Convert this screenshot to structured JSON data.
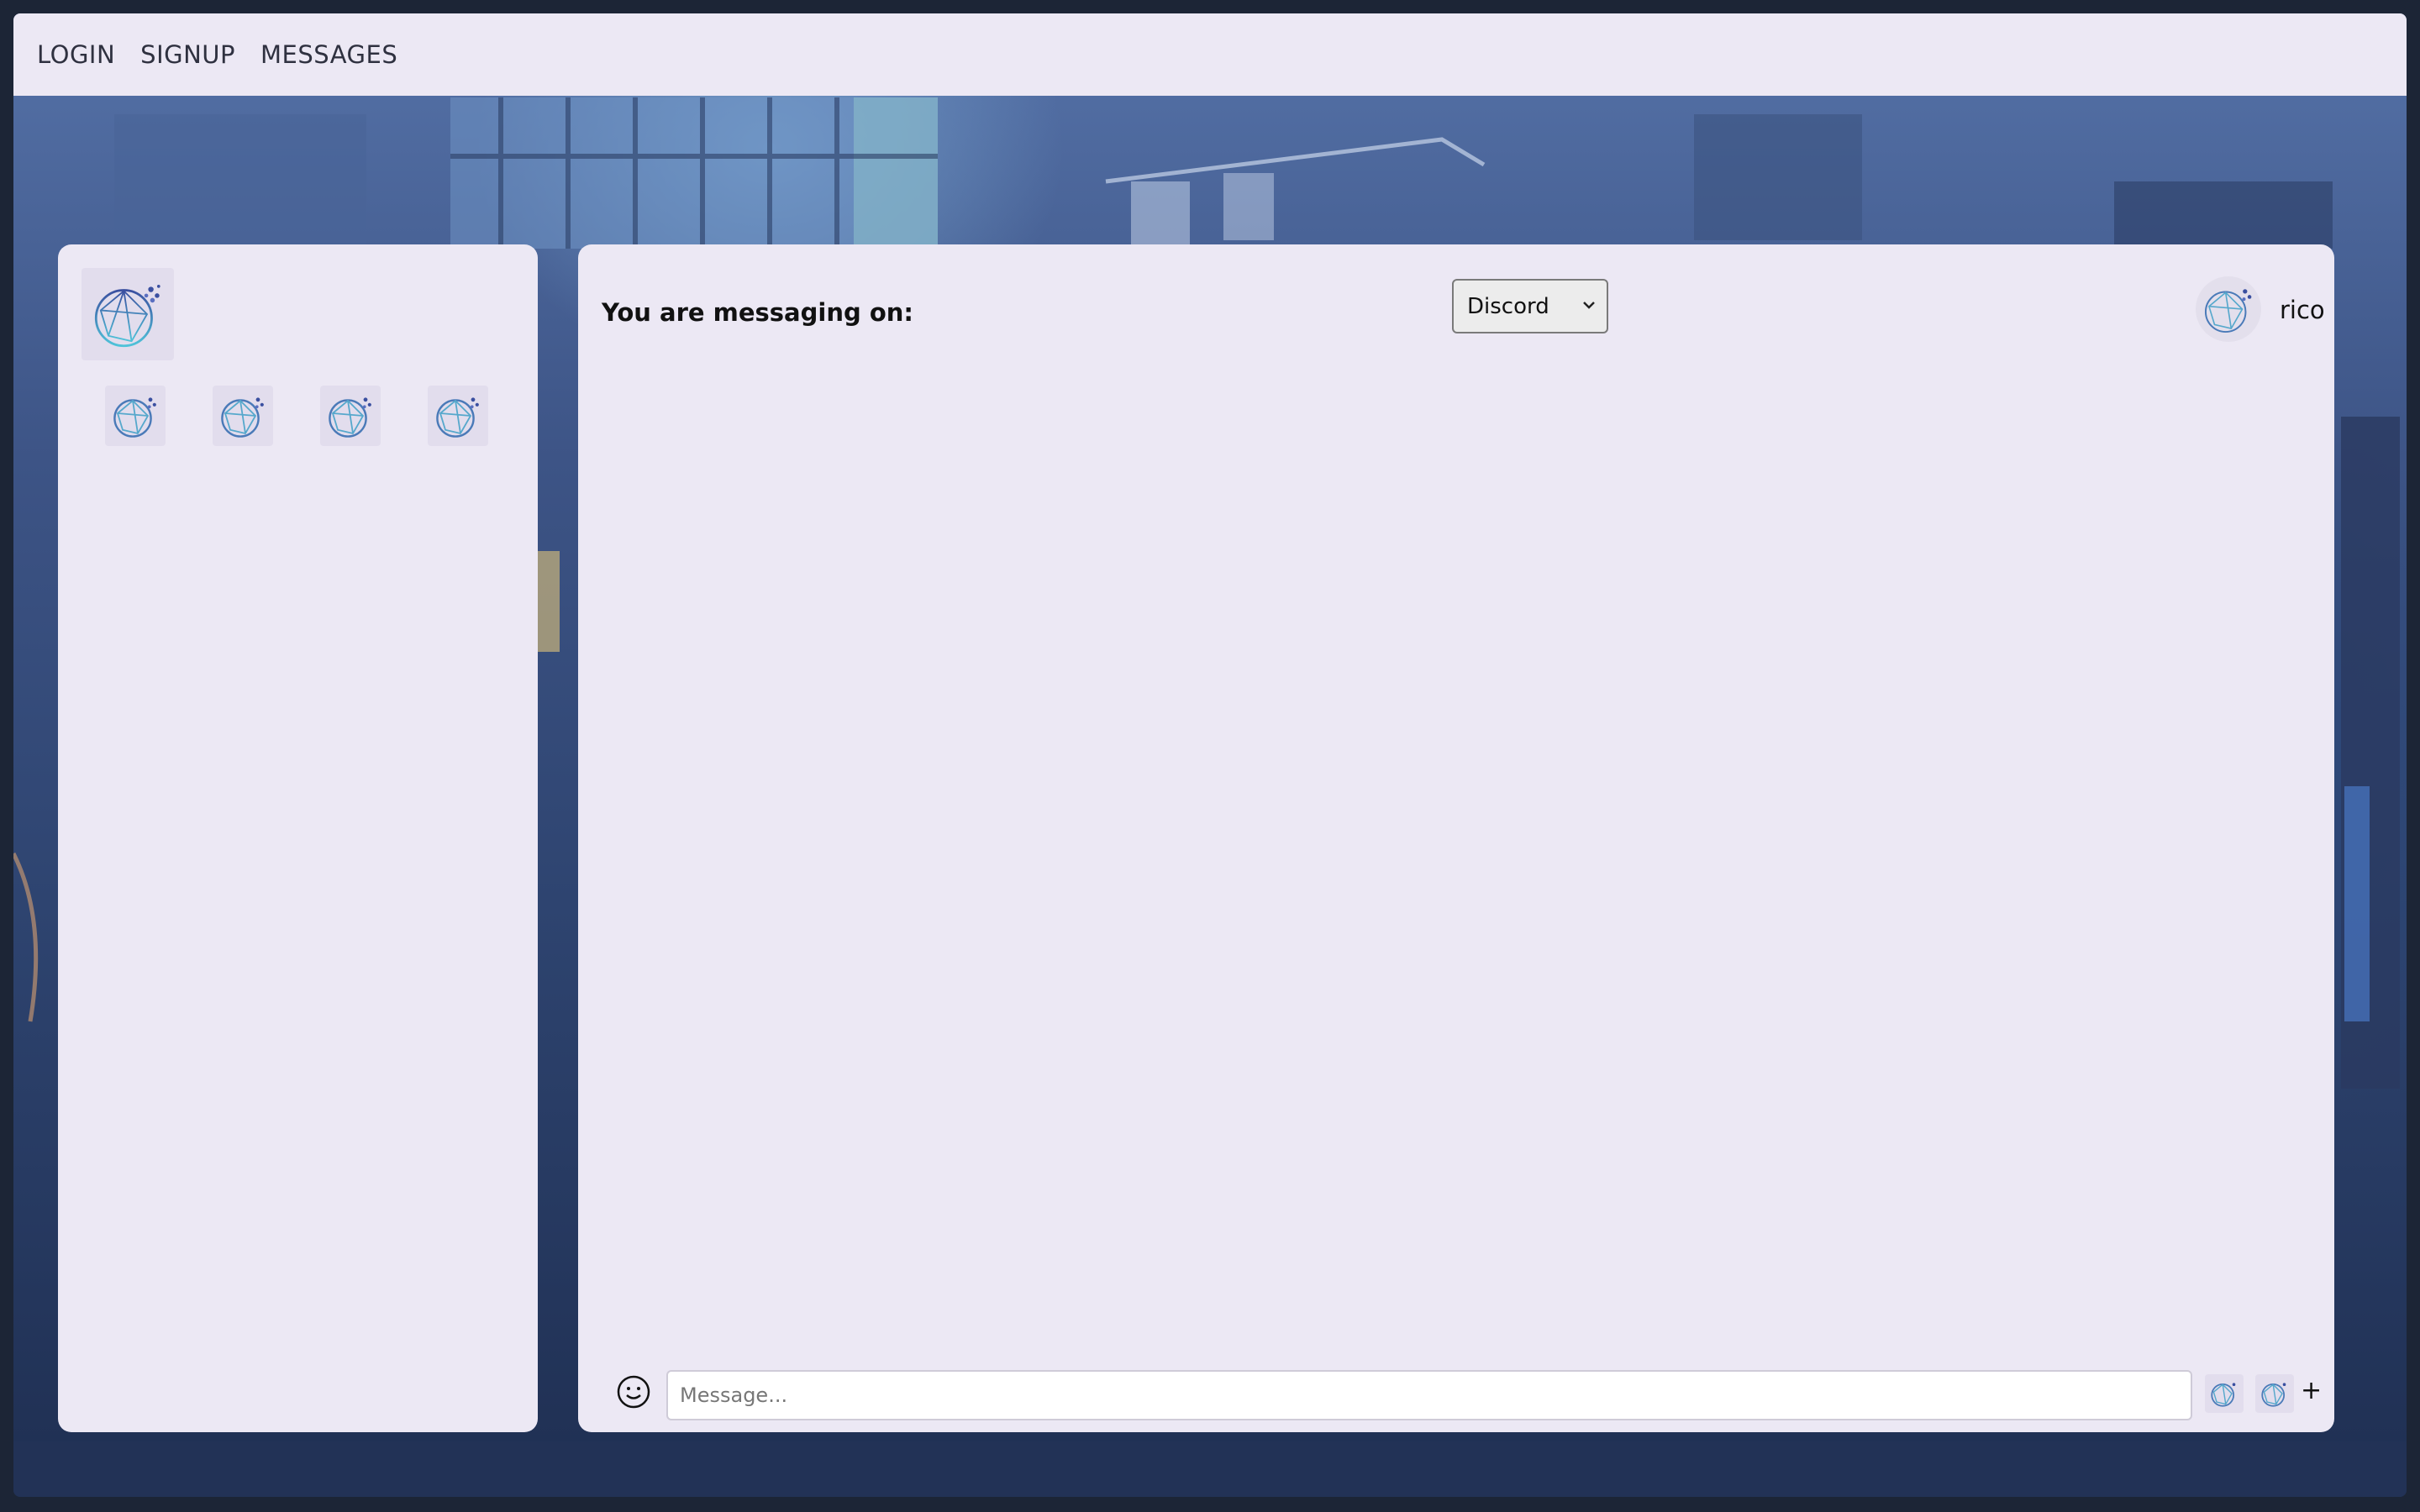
{
  "nav": {
    "links": [
      "LOGIN",
      "SIGNUP",
      "MESSAGES"
    ]
  },
  "sidebar": {
    "main_logo_icon": "globe-network-logo-icon",
    "contact_icons": [
      "globe-network-logo-icon",
      "globe-network-logo-icon",
      "globe-network-logo-icon",
      "globe-network-logo-icon"
    ]
  },
  "chat": {
    "header_label": "You are messaging on:",
    "platform_selected": "Discord",
    "username": "rico",
    "avatar_icon": "globe-network-logo-icon"
  },
  "composer": {
    "placeholder": "Message...",
    "emoji_icon": "smiley-face-icon",
    "plus_label": "+"
  },
  "colors": {
    "panel_bg": "#ece8f4",
    "logo_tile": "#e2dded",
    "window_frame": "#1c2536"
  }
}
